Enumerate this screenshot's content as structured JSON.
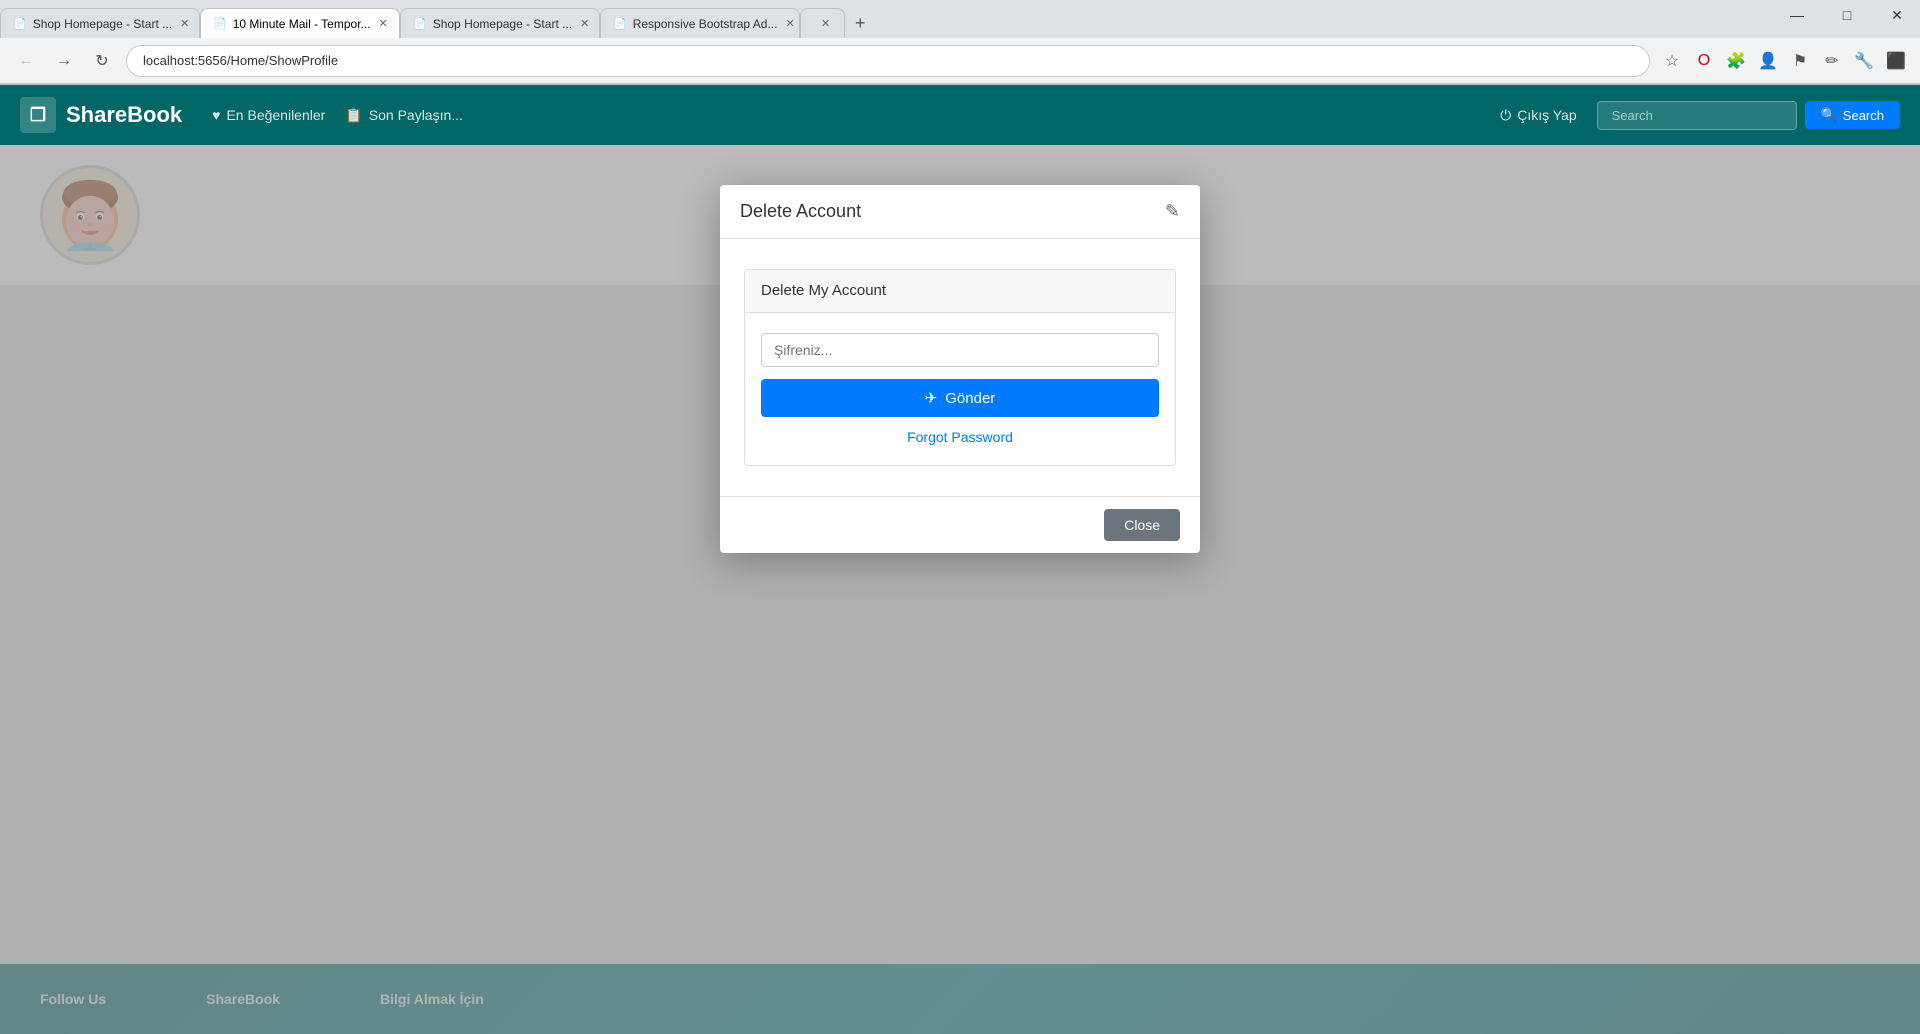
{
  "browser": {
    "tabs": [
      {
        "id": "tab1",
        "title": "Shop Homepage - Start ...",
        "active": false,
        "icon": "📄"
      },
      {
        "id": "tab2",
        "title": "10 Minute Mail - Tempor...",
        "active": true,
        "icon": "📄"
      },
      {
        "id": "tab3",
        "title": "Shop Homepage - Start ...",
        "active": false,
        "icon": "📄"
      },
      {
        "id": "tab4",
        "title": "Responsive Bootstrap Ad...",
        "active": false,
        "icon": "📄"
      },
      {
        "id": "tab5",
        "title": "",
        "active": false,
        "icon": ""
      }
    ],
    "address": "localhost:5656/Home/ShowProfile",
    "window_controls": {
      "minimize": "—",
      "maximize": "□",
      "close": "✕"
    }
  },
  "navbar": {
    "brand": "ShareBook",
    "brand_icon": "❐",
    "links": [
      {
        "label": "En Beğenilenler",
        "icon": "♥"
      },
      {
        "label": "Son Paylaşın...",
        "icon": "📋"
      },
      {
        "label": "Çıkış Yap",
        "icon": "⏻"
      }
    ],
    "search_placeholder": "Search",
    "search_button": "Search"
  },
  "modal": {
    "title": "Delete Account",
    "close_icon": "✎",
    "card": {
      "header": "Delete My Account",
      "password_placeholder": "Şifreniz...",
      "submit_button": "Gönder",
      "submit_icon": "✈",
      "forgot_password": "Forgot Password"
    },
    "close_button": "Close"
  },
  "footer": {
    "columns": [
      {
        "label": "Follow Us"
      },
      {
        "label": "ShareBook",
        "icon": "❐"
      },
      {
        "label": "Bilgi Almak İçin"
      }
    ]
  }
}
